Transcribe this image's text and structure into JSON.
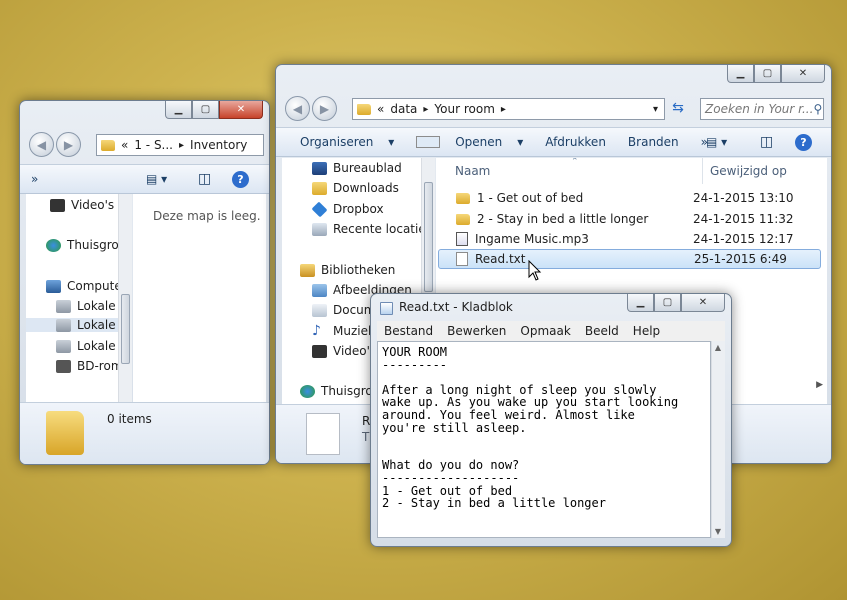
{
  "inventory_window": {
    "address": {
      "prefix": "«",
      "segment1": "1 - S...",
      "arrow": "▸",
      "segment2": "Inventory"
    },
    "toolbar_more": "»",
    "empty_message": "Deze map is leeg.",
    "nav_items": [
      "Video's",
      "Thuisgroe",
      "Compute",
      "Lokale s",
      "Lokale s",
      "Lokale s",
      "BD-rom"
    ],
    "status": "0 items"
  },
  "explorer_window": {
    "address": {
      "prefix": "«",
      "segment1": "data",
      "arrow1": "▸",
      "segment2": "Your room",
      "arrow2": "▸"
    },
    "search_placeholder": "Zoeken in Your r...",
    "toolbar": {
      "organize": "Organiseren",
      "open": "Openen",
      "print": "Afdrukken",
      "burn": "Branden",
      "more": "»"
    },
    "nav_items": [
      "Bureaublad",
      "Downloads",
      "Dropbox",
      "Recente locaties",
      "Bibliotheken",
      "Afbeeldingen",
      "Docum",
      "Muziek",
      "Video's",
      "Thuisgroep"
    ],
    "columns": {
      "name": "Naam",
      "modified": "Gewijzigd op"
    },
    "files": [
      {
        "name": "1 - Get out of bed",
        "date": "24-1-2015 13:10",
        "kind": "folder"
      },
      {
        "name": "2 - Stay in bed a little longer",
        "date": "24-1-2015 11:32",
        "kind": "folder"
      },
      {
        "name": "Ingame Music.mp3",
        "date": "24-1-2015 12:17",
        "kind": "audio"
      },
      {
        "name": "Read.txt",
        "date": "25-1-2015 6:49",
        "kind": "text"
      }
    ],
    "details": {
      "line1": "R",
      "line2": "T"
    }
  },
  "notepad_window": {
    "title": "Read.txt - Kladblok",
    "menu": [
      "Bestand",
      "Bewerken",
      "Opmaak",
      "Beeld",
      "Help"
    ],
    "text": "YOUR ROOM\n---------\n\nAfter a long night of sleep you slowly\nwake up. As you wake up you start looking\naround. You feel weird. Almost like\nyou're still asleep.\n\n\nWhat do you do now?\n-------------------\n1 - Get out of bed\n2 - Stay in bed a little longer"
  }
}
